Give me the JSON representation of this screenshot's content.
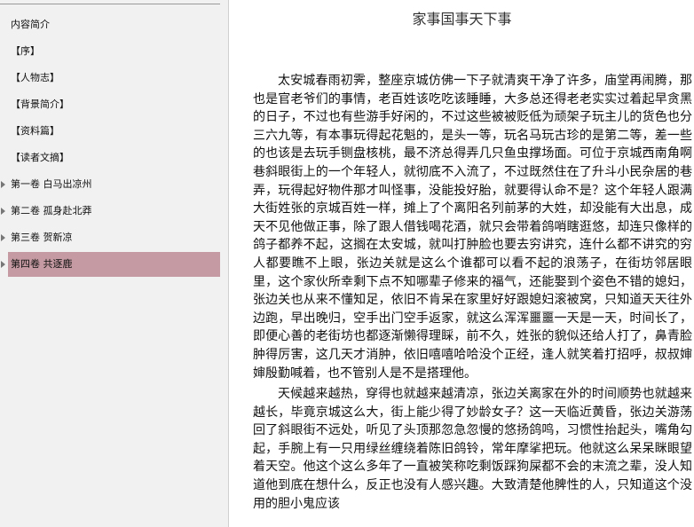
{
  "toc": {
    "items": [
      {
        "label": "内容简介",
        "has_children": false,
        "selected": false
      },
      {
        "label": "【序】",
        "has_children": false,
        "selected": false
      },
      {
        "label": "【人物志】",
        "has_children": false,
        "selected": false
      },
      {
        "label": "【背景简介】",
        "has_children": false,
        "selected": false
      },
      {
        "label": "【资料篇】",
        "has_children": false,
        "selected": false
      },
      {
        "label": "【读者文摘】",
        "has_children": false,
        "selected": false
      },
      {
        "label": "第一卷 白马出凉州",
        "has_children": true,
        "selected": false
      },
      {
        "label": "第二卷 孤身赴北莽",
        "has_children": true,
        "selected": false
      },
      {
        "label": "第三卷 贺新凉",
        "has_children": true,
        "selected": false
      },
      {
        "label": "第四卷 共逐鹿",
        "has_children": true,
        "selected": true
      }
    ]
  },
  "content": {
    "title": "家事国事天下事",
    "paragraphs": [
      "太安城春雨初霁，整座京城仿佛一下子就清爽干净了许多，庙堂再闹腾，那也是官老爷们的事情，老百姓该吃吃该睡睡，大多总还得老老实实过着起早贪黑的日子，不过也有些游手好闲的，不过这些被被贬低为顽架子玩主儿的货色也分三六九等，有本事玩得起花魁的，是头一等，玩名马玩古珍的是第二等，差一些的也该是去玩手铡盘核桃，最不济总得弄几只鱼虫撑场面。可位于京城西南角啊巷斜眼街上的一个年轻人，就彻底不入流了，不过既然住在了升斗小民杂居的巷弄，玩得起好物件那才叫怪事，没能投好胎，就要得认命不是？这个年轻人跟满大街姓张的京城百姓一样，摊上了个离阳名列前茅的大姓，却没能有大出息，成天不见他做正事，除了跟人借钱喝花酒，就只会带着鸽哨瞎逛悠，却连只像样的鸽子都养不起，这搁在太安城，就叫打肿脸也要去穷讲究，连什么都不讲究的穷人都要瞧不上眼，张边关就是这么个谁都可以看不起的浪荡子，在街坊邻居眼里，这个家伙所幸剩下点不知哪辈子修来的福气，还能娶到个姿色不错的媳妇，张边关也从来不懂知足，依旧不肯呆在家里好好跟媳妇滚被窝，只知道天天往外边跑，早出晚归，空手出门空手返家，就这么浑浑噩噩一天是一天，时间长了，即便心善的老街坊也都逐渐懒得理睬，前不久，姓张的貌似还给人打了，鼻青脸肿得厉害，这几天才消肿，依旧嘻嘻哈哈没个正经，逢人就笑着打招呼，叔叔婶婶殷勤喊着，也不管别人是不是搭理他。",
      "天候越来越热，穿得也就越来越清凉，张边关离家在外的时间顺势也就越来越长，毕竟京城这么大，街上能少得了妙龄女子？这一天临近黄昏，张边关游荡回了斜眼街不远处，听见了头顶那忽急忽慢的悠扬鸽鸣，习惯性抬起头，嘴角勾起，手腕上有一只用绿丝缠绕着陈旧鸽铃，常年摩挲把玩。他就这么呆呆眯眼望着天空。他这个这么多年了一直被笑称吃剩饭踩狗屎都不会的末流之辈，没人知道他到底在想什么，反正也没有人感兴趣。大致清楚他脾性的人，只知道这个没用的胆小鬼应该"
    ]
  }
}
